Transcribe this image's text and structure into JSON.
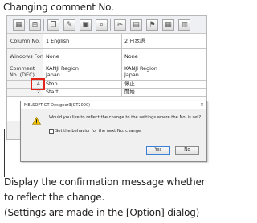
{
  "heading": "Changing comment No.",
  "toolbar": {
    "icons": [
      "table-icon",
      "grid-add-icon",
      "copy-icon",
      "edit-icon",
      "image-icon",
      "search-icon",
      "cut-icon",
      "clipboard-icon",
      "flag-icon",
      "grid-icon",
      "table-view-icon"
    ]
  },
  "table": {
    "column_no_label": "Column No.",
    "column_1": "1 English",
    "column_2": "2 日本語",
    "windows_font_label": "Windows Font",
    "windows_font_1": "None",
    "windows_font_2": "None",
    "comment_no_label": "Comment No. (DEC)",
    "kanji_region_1": "KANJI Region",
    "region_1": "Japan",
    "kanji_region_2": "KANJI Region",
    "region_2": "Japan",
    "rows": [
      {
        "no": "4",
        "english": "Stop",
        "japanese": "停止"
      },
      {
        "no": "2",
        "english": "Start",
        "japanese": "開始"
      }
    ]
  },
  "dialog": {
    "title": "MELSOFT GT Designer3(GT2000)",
    "close_glyph": "✕",
    "message": "Would you like to reflect the change to the settings where the No. is set?",
    "checkbox_label": "Set the behavior for the next No. change",
    "yes_label": "Yes",
    "no_label": "No"
  },
  "caption": {
    "line1": "Display the confirmation message whether",
    "line2": "to reflect the change.",
    "line3": "(Settings are made in the [Option] dialog)"
  },
  "colors": {
    "highlight": "#e2231a",
    "warning": "#f2c200"
  }
}
